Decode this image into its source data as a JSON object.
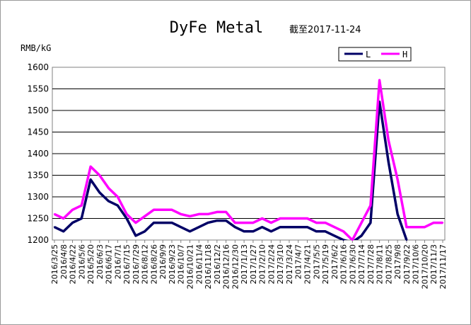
{
  "chart_data": {
    "type": "line",
    "title": "DyFe Metal",
    "subtitle": "截至2017-11-24",
    "ylabel": "RMB/kG",
    "xlabel": "",
    "ylim": [
      1200,
      1600
    ],
    "yticks": [
      1200,
      1250,
      1300,
      1350,
      1400,
      1450,
      1500,
      1550,
      1600
    ],
    "grid": "horizontal",
    "legend_position": "top-right",
    "x": [
      "2016/3/25",
      "2016/4/8",
      "2016/4/22",
      "2016/5/6",
      "2016/5/20",
      "2016/6/3",
      "2016/6/17",
      "2016/7/1",
      "2016/7/15",
      "2016/7/29",
      "2016/8/12",
      "2016/8/26",
      "2016/9/9",
      "2016/9/23",
      "2016/10/7",
      "2016/10/21",
      "2016/11/4",
      "2016/11/18",
      "2016/12/2",
      "2016/12/16",
      "2016/12/30",
      "2017/1/13",
      "2017/1/27",
      "2017/2/10",
      "2017/2/24",
      "2017/3/10",
      "2017/3/24",
      "2017/4/7",
      "2017/4/21",
      "2017/5/5",
      "2017/5/19",
      "2017/6/2",
      "2017/6/16",
      "2017/6/30",
      "2017/7/14",
      "2017/7/28",
      "2017/8/11",
      "2017/8/25",
      "2017/9/8",
      "2017/9/22",
      "2017/10/6",
      "2017/10/20",
      "2017/11/3",
      "2017/11/17"
    ],
    "series": [
      {
        "name": "L",
        "color": "#000066",
        "values": [
          1230,
          1220,
          1240,
          1250,
          1340,
          1310,
          1290,
          1280,
          1250,
          1210,
          1220,
          1240,
          1240,
          1240,
          1230,
          1220,
          1230,
          1240,
          1245,
          1245,
          1230,
          1220,
          1220,
          1230,
          1220,
          1230,
          1230,
          1230,
          1230,
          1220,
          1220,
          1210,
          1200,
          1195,
          1210,
          1240,
          1520,
          1380,
          1260,
          1200,
          null,
          null,
          null,
          null
        ]
      },
      {
        "name": "H",
        "color": "#ff00ff",
        "values": [
          1260,
          1250,
          1270,
          1280,
          1370,
          1350,
          1320,
          1300,
          1260,
          1240,
          1255,
          1270,
          1270,
          1270,
          1260,
          1255,
          1260,
          1260,
          1265,
          1265,
          1240,
          1240,
          1240,
          1250,
          1240,
          1250,
          1250,
          1250,
          1250,
          1240,
          1240,
          1230,
          1220,
          1200,
          1240,
          1280,
          1570,
          1430,
          1340,
          1230,
          1230,
          1230,
          1240,
          1240
        ]
      }
    ]
  }
}
